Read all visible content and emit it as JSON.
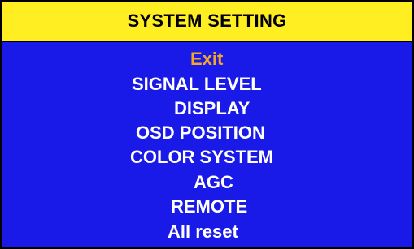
{
  "header": {
    "title": "SYSTEM SETTING"
  },
  "menu": {
    "selected_index": 0,
    "items": [
      {
        "label": "Exit"
      },
      {
        "label": "SIGNAL LEVEL"
      },
      {
        "label": "DISPLAY"
      },
      {
        "label": "OSD POSITION"
      },
      {
        "label": "COLOR SYSTEM"
      },
      {
        "label": "AGC"
      },
      {
        "label": "REMOTE"
      },
      {
        "label": "All reset"
      }
    ]
  },
  "colors": {
    "background": "#1a1ae8",
    "header": "#ffee22",
    "text": "#ffffff",
    "selected_text": "#f5a623",
    "border": "#000000"
  }
}
